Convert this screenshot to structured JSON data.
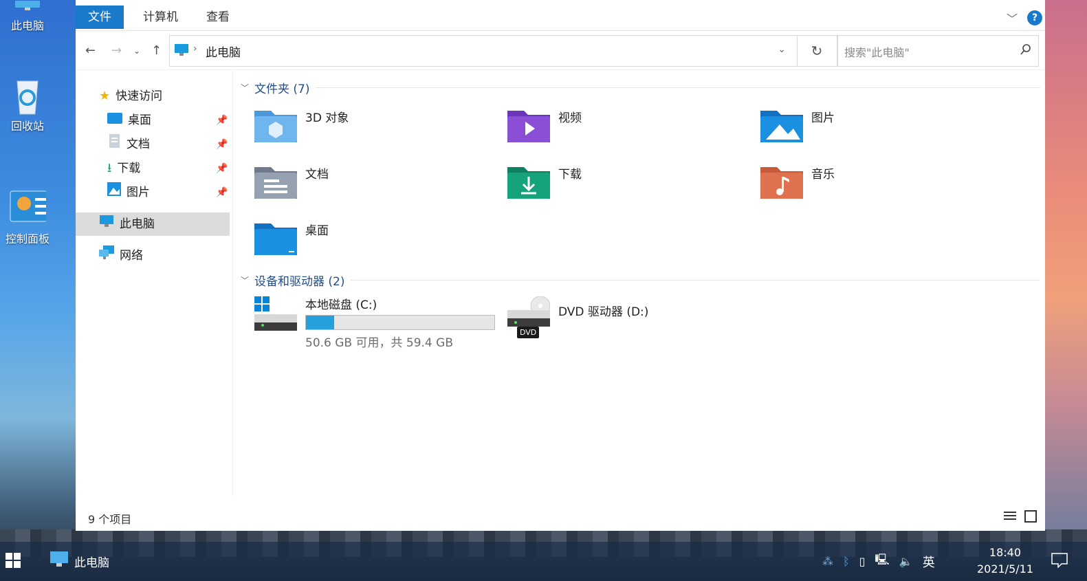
{
  "desktop": {
    "icons": [
      {
        "label": "此电脑",
        "icon": "computer-icon"
      },
      {
        "label": "回收站",
        "icon": "recycle-bin-icon"
      },
      {
        "label": "控制面板",
        "icon": "control-panel-icon"
      }
    ]
  },
  "ribbon": {
    "tabs": [
      "文件",
      "计算机",
      "查看"
    ],
    "active_tab": "文件",
    "help_label": "?"
  },
  "address_bar": {
    "path": "此电脑",
    "search_placeholder": "搜索\"此电脑\""
  },
  "sidebar": {
    "quick_access": "快速访问",
    "quick_items": [
      {
        "label": "桌面",
        "icon": "desktop-folder-icon"
      },
      {
        "label": "文档",
        "icon": "documents-icon"
      },
      {
        "label": "下载",
        "icon": "download-icon"
      },
      {
        "label": "图片",
        "icon": "pictures-icon"
      }
    ],
    "this_pc": "此电脑",
    "network": "网络"
  },
  "content": {
    "folders_header": "文件夹 (7)",
    "folders": [
      {
        "label": "3D 对象",
        "icon": "3d-objects-folder-icon",
        "color": "#5aa7e6"
      },
      {
        "label": "视频",
        "icon": "videos-folder-icon",
        "color": "#8a4fd6"
      },
      {
        "label": "图片",
        "icon": "pictures-folder-icon",
        "color": "#1b8fe0"
      },
      {
        "label": "文档",
        "icon": "documents-folder-icon",
        "color": "#8a95a5"
      },
      {
        "label": "下载",
        "icon": "downloads-folder-icon",
        "color": "#16a37c"
      },
      {
        "label": "音乐",
        "icon": "music-folder-icon",
        "color": "#e0714e"
      },
      {
        "label": "桌面",
        "icon": "desktop-folder-icon",
        "color": "#1b8fe0"
      }
    ],
    "devices_header": "设备和驱动器 (2)",
    "drives": [
      {
        "label": "本地磁盘 (C:)",
        "detail": "50.6 GB 可用，共 59.4 GB",
        "used_fraction": 0.15
      },
      {
        "label": "DVD 驱动器 (D:)",
        "badge": "DVD"
      }
    ]
  },
  "status_bar": {
    "items_count": "9 个项目"
  },
  "taskbar": {
    "active_app": "此电脑",
    "ime": "英",
    "time": "18:40",
    "date": "2021/5/11"
  },
  "colors": {
    "accent": "#1979ca",
    "group_header": "#1e4e8c"
  }
}
